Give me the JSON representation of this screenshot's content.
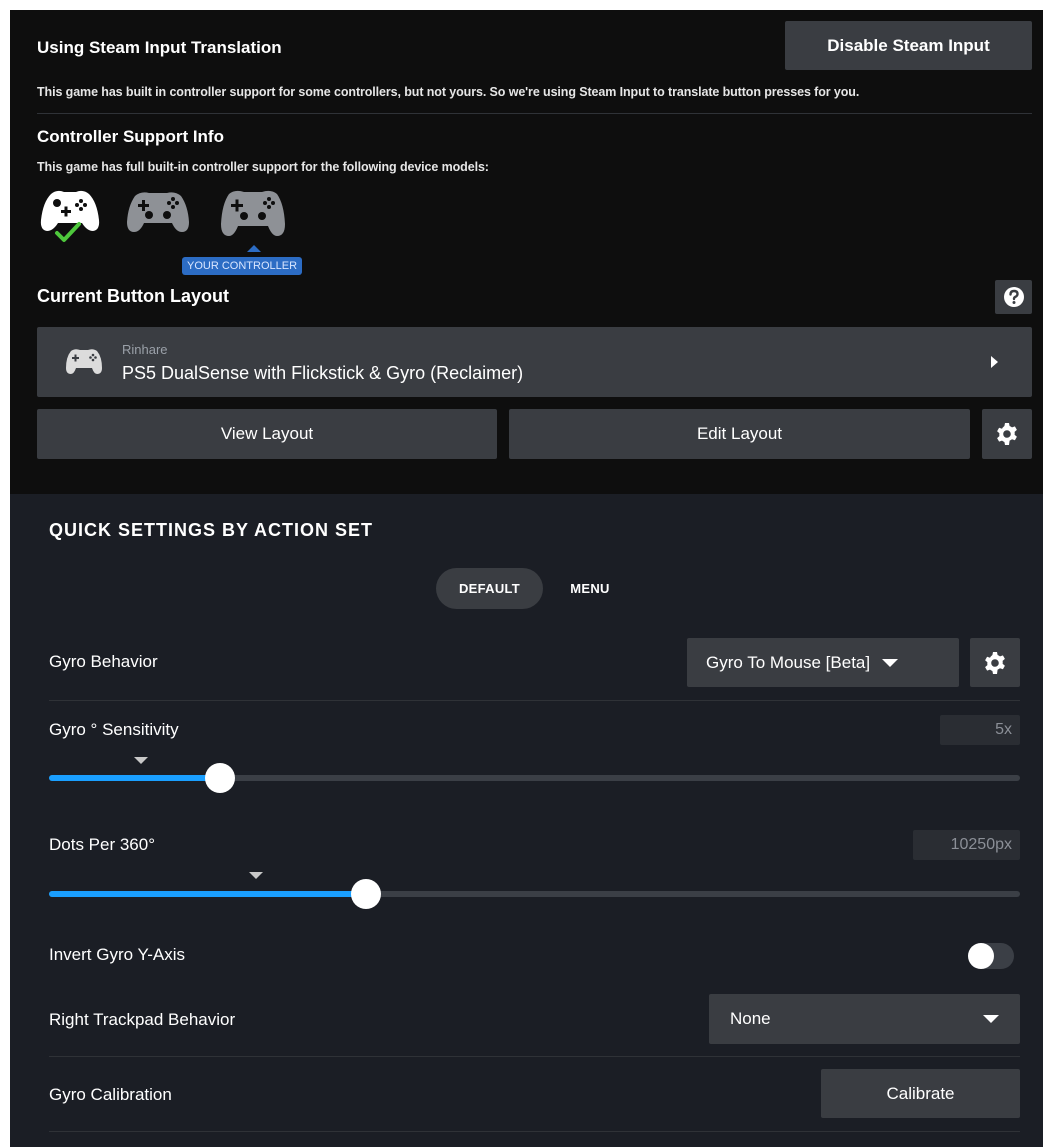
{
  "steam_input": {
    "title": "Using Steam Input Translation",
    "disable_button_label": "Disable Steam Input",
    "description": "This game has built in controller support for some controllers, but not yours. So we're using Steam Input to translate button presses for you."
  },
  "controller_support": {
    "title": "Controller Support Info",
    "description": "This game has full built-in controller support for the following device models:",
    "devices": [
      {
        "icon": "xbox-controller-icon",
        "supported": true
      },
      {
        "icon": "ps4-controller-icon",
        "supported": false
      },
      {
        "icon": "ps5-controller-icon",
        "supported": false
      }
    ],
    "your_controller_tooltip": "YOUR CONTROLLER"
  },
  "button_layout": {
    "title": "Current Button Layout",
    "author": "Rinhare",
    "name": "PS5 DualSense with Flickstick & Gyro (Reclaimer)",
    "view_label": "View Layout",
    "edit_label": "Edit Layout"
  },
  "quick_settings": {
    "title": "QUICK SETTINGS BY ACTION SET",
    "tabs": [
      {
        "label": "DEFAULT",
        "active": true
      },
      {
        "label": "MENU",
        "active": false
      }
    ],
    "gyro_behavior": {
      "label": "Gyro Behavior",
      "value": "Gyro To Mouse [Beta]"
    },
    "gyro_sensitivity": {
      "label": "Gyro ° Sensitivity",
      "value": "5x",
      "fraction": 0.176,
      "default_fraction": 0.095
    },
    "dots_per_360": {
      "label": "Dots Per 360°",
      "value": "10250px",
      "fraction": 0.326,
      "default_fraction": 0.213
    },
    "invert_gyro": {
      "label": "Invert Gyro Y-Axis",
      "enabled": false
    },
    "right_trackpad": {
      "label": "Right Trackpad Behavior",
      "value": "None"
    },
    "gyro_calibration": {
      "label": "Gyro Calibration",
      "button_label": "Calibrate"
    }
  },
  "colors": {
    "accent": "#1a9fff",
    "tooltip": "#2c6cc4",
    "check": "#4ec83c"
  }
}
